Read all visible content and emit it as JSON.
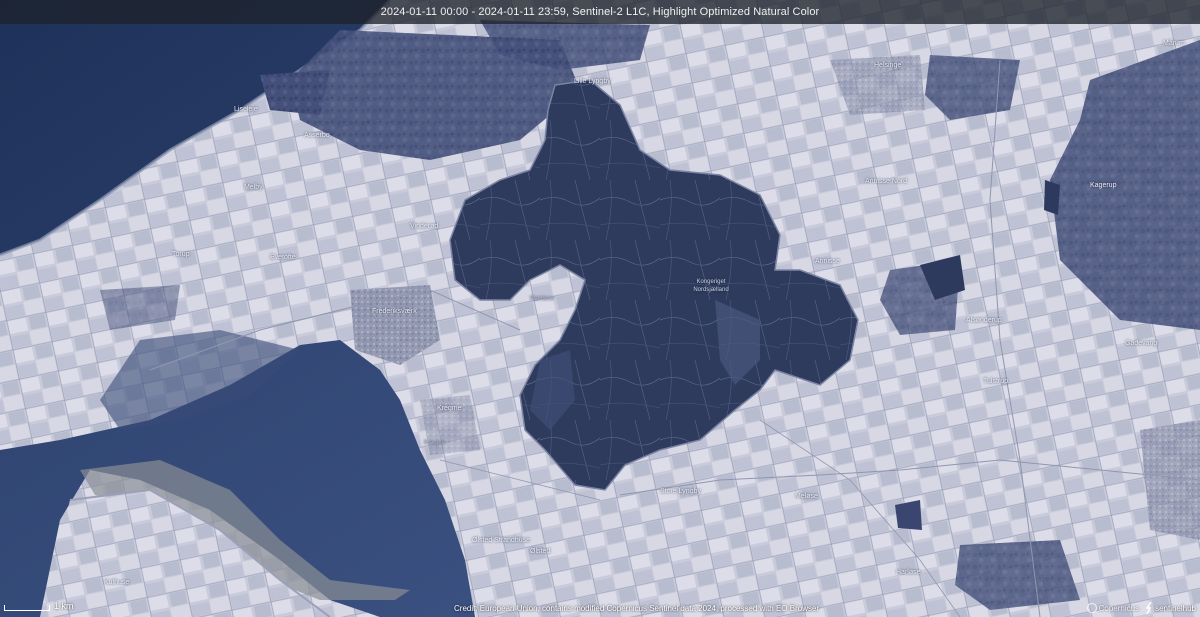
{
  "banner": {
    "text": "2024-01-11 00:00 - 2024-01-11 23:59, Sentinel-2 L1C, Highlight Optimized Natural Color"
  },
  "places": [
    {
      "key": "lille_lyngby",
      "text": "Lille Lyngby"
    },
    {
      "key": "liseleje",
      "text": "Liseleje"
    },
    {
      "key": "asserbo",
      "text": "Asserbo"
    },
    {
      "key": "melby",
      "text": "Melby"
    },
    {
      "key": "vinderod",
      "text": "Vinderød"
    },
    {
      "key": "torup",
      "text": "Torup"
    },
    {
      "key": "evetofte",
      "text": "Evetofte"
    },
    {
      "key": "frederiksvaerk",
      "text": "Frederiksværk"
    },
    {
      "key": "kregme",
      "text": "Kregme"
    },
    {
      "key": "kregme2",
      "text": "Kregme"
    },
    {
      "key": "ølsted",
      "text": "Ølsted"
    },
    {
      "key": "ølsted_strandhuse",
      "text": "Ølsted Strandhuse"
    },
    {
      "key": "kulhuse",
      "text": "Kulhuse"
    },
    {
      "key": "store_lyngby",
      "text": "Store Lyngby"
    },
    {
      "key": "meløse",
      "text": "Meløse"
    },
    {
      "key": "annisse_nord",
      "text": "Annisse Nord"
    },
    {
      "key": "annisse",
      "text": "Annisse"
    },
    {
      "key": "alsønderup",
      "text": "Alsønderup"
    },
    {
      "key": "helsinge",
      "text": "Helsinge"
    },
    {
      "key": "tulstrup",
      "text": "Tulstrup"
    },
    {
      "key": "kagerup",
      "text": "Kagerup"
    },
    {
      "key": "godeyang",
      "text": "Gadevang"
    },
    {
      "key": "harlose",
      "text": "Harløse"
    },
    {
      "key": "arresø",
      "text": "Kongeriget Nordsjælland"
    },
    {
      "key": "ramlose",
      "text": "Ramløse"
    },
    {
      "key": "maarum",
      "text": "Mårum"
    }
  ],
  "scale": {
    "label": "1 km"
  },
  "credit": {
    "text": "Credit: European Union, contains modified Copernicus Sentinel data 2024, processed with EO Browser"
  },
  "logos": {
    "copernicus": "Copernicus",
    "sentinelhub": "sentinelhub"
  }
}
